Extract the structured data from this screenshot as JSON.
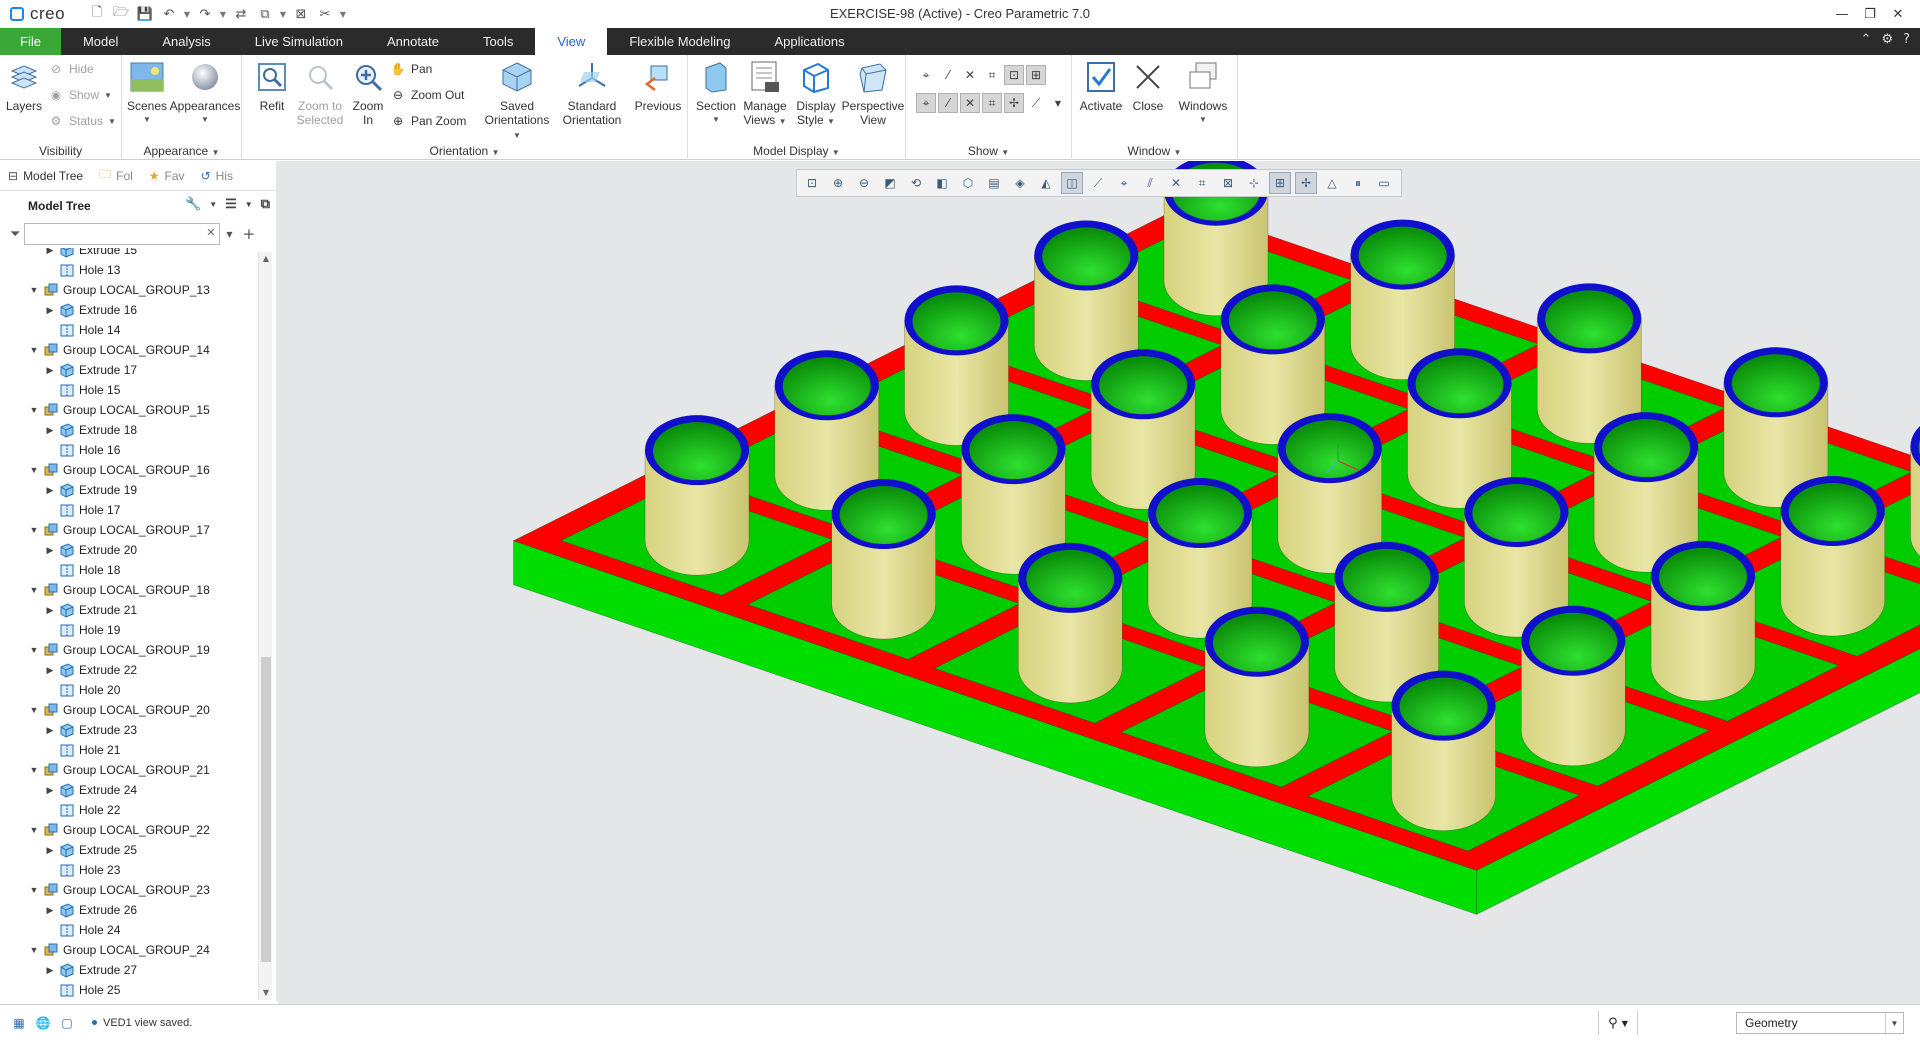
{
  "app": {
    "logo_text": "creo",
    "window_title": "EXERCISE-98 (Active) - Creo Parametric 7.0"
  },
  "tabs": [
    {
      "label": "File"
    },
    {
      "label": "Model"
    },
    {
      "label": "Analysis"
    },
    {
      "label": "Live Simulation"
    },
    {
      "label": "Annotate"
    },
    {
      "label": "Tools"
    },
    {
      "label": "View"
    },
    {
      "label": "Flexible Modeling"
    },
    {
      "label": "Applications"
    }
  ],
  "ribbon": {
    "visibility": {
      "label": "Visibility",
      "layers": "Layers",
      "hide": "Hide",
      "show": "Show",
      "status": "Status"
    },
    "appearance": {
      "label": "Appearance",
      "scenes": "Scenes",
      "appearances": "Appearances"
    },
    "orientation": {
      "label": "Orientation",
      "refit": "Refit",
      "zoom_selected_1": "Zoom to",
      "zoom_selected_2": "Selected",
      "zoom_in_1": "Zoom",
      "zoom_in_2": "In",
      "pan": "Pan",
      "zoom_out": "Zoom Out",
      "pan_zoom": "Pan Zoom",
      "saved_1": "Saved",
      "saved_2": "Orientations",
      "standard_1": "Standard",
      "standard_2": "Orientation",
      "previous": "Previous"
    },
    "model_display": {
      "label": "Model Display",
      "section": "Section",
      "manage_1": "Manage",
      "manage_2": "Views",
      "display_1": "Display",
      "display_2": "Style",
      "perspective_1": "Perspective",
      "perspective_2": "View"
    },
    "show": {
      "label": "Show"
    },
    "window": {
      "label": "Window",
      "activate": "Activate",
      "close": "Close",
      "windows": "Windows"
    }
  },
  "navigator": {
    "tabs": [
      "Model Tree",
      "Fol",
      "Fav",
      "His"
    ],
    "header": "Model Tree",
    "search_value": ""
  },
  "tree": {
    "items": [
      {
        "type": "extrude",
        "label": "Extrude 15",
        "level": 1,
        "partial": true
      },
      {
        "type": "hole",
        "label": "Hole 13",
        "level": 1
      },
      {
        "type": "group",
        "label": "Group LOCAL_GROUP_13",
        "level": 0
      },
      {
        "type": "extrude",
        "label": "Extrude 16",
        "level": 1
      },
      {
        "type": "hole",
        "label": "Hole 14",
        "level": 1
      },
      {
        "type": "group",
        "label": "Group LOCAL_GROUP_14",
        "level": 0
      },
      {
        "type": "extrude",
        "label": "Extrude 17",
        "level": 1
      },
      {
        "type": "hole",
        "label": "Hole 15",
        "level": 1
      },
      {
        "type": "group",
        "label": "Group LOCAL_GROUP_15",
        "level": 0
      },
      {
        "type": "extrude",
        "label": "Extrude 18",
        "level": 1
      },
      {
        "type": "hole",
        "label": "Hole 16",
        "level": 1
      },
      {
        "type": "group",
        "label": "Group LOCAL_GROUP_16",
        "level": 0
      },
      {
        "type": "extrude",
        "label": "Extrude 19",
        "level": 1
      },
      {
        "type": "hole",
        "label": "Hole 17",
        "level": 1
      },
      {
        "type": "group",
        "label": "Group LOCAL_GROUP_17",
        "level": 0
      },
      {
        "type": "extrude",
        "label": "Extrude 20",
        "level": 1
      },
      {
        "type": "hole",
        "label": "Hole 18",
        "level": 1
      },
      {
        "type": "group",
        "label": "Group LOCAL_GROUP_18",
        "level": 0
      },
      {
        "type": "extrude",
        "label": "Extrude 21",
        "level": 1
      },
      {
        "type": "hole",
        "label": "Hole 19",
        "level": 1
      },
      {
        "type": "group",
        "label": "Group LOCAL_GROUP_19",
        "level": 0
      },
      {
        "type": "extrude",
        "label": "Extrude 22",
        "level": 1
      },
      {
        "type": "hole",
        "label": "Hole 20",
        "level": 1
      },
      {
        "type": "group",
        "label": "Group LOCAL_GROUP_20",
        "level": 0
      },
      {
        "type": "extrude",
        "label": "Extrude 23",
        "level": 1
      },
      {
        "type": "hole",
        "label": "Hole 21",
        "level": 1
      },
      {
        "type": "group",
        "label": "Group LOCAL_GROUP_21",
        "level": 0
      },
      {
        "type": "extrude",
        "label": "Extrude 24",
        "level": 1
      },
      {
        "type": "hole",
        "label": "Hole 22",
        "level": 1
      },
      {
        "type": "group",
        "label": "Group LOCAL_GROUP_22",
        "level": 0
      },
      {
        "type": "extrude",
        "label": "Extrude 25",
        "level": 1
      },
      {
        "type": "hole",
        "label": "Hole 23",
        "level": 1
      },
      {
        "type": "group",
        "label": "Group LOCAL_GROUP_23",
        "level": 0
      },
      {
        "type": "extrude",
        "label": "Extrude 26",
        "level": 1
      },
      {
        "type": "hole",
        "label": "Hole 24",
        "level": 1
      },
      {
        "type": "group",
        "label": "Group LOCAL_GROUP_24",
        "level": 0
      },
      {
        "type": "extrude",
        "label": "Extrude 27",
        "level": 1
      },
      {
        "type": "hole",
        "label": "Hole 25",
        "level": 1
      }
    ]
  },
  "model": {
    "colors": {
      "frame_top": "#ff0000",
      "frame_side": "#00dd00",
      "floor": "#00cc00",
      "cylinder": "#d9d58a",
      "rim": "#1010cc",
      "hole": "#1fbf1f",
      "background": "#e5e6e8"
    },
    "grid": {
      "rows": 5,
      "cols": 5
    }
  },
  "status": {
    "message": "VED1 view saved.",
    "filter_value": "Geometry"
  },
  "colors": {
    "file_tab": "#3aa838",
    "tab_bar": "#2b2b2b",
    "active_tab_text": "#2266cc"
  }
}
